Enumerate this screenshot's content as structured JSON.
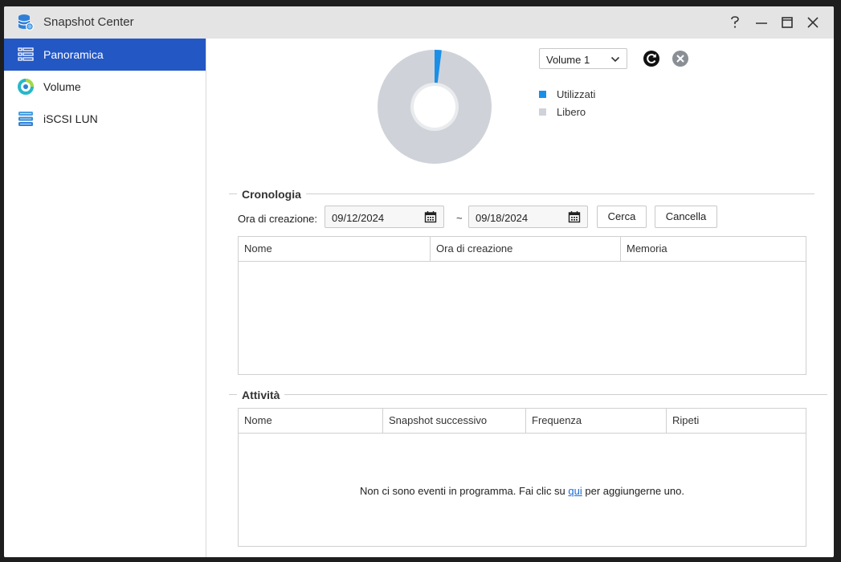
{
  "window": {
    "title": "Snapshot Center",
    "help_label": "?",
    "app_icon": "database-camera-icon"
  },
  "sidebar": {
    "items": [
      {
        "label": "Panoramica",
        "icon": "grid-list-icon",
        "active": true
      },
      {
        "label": "Volume",
        "icon": "volume-ring-icon",
        "active": false
      },
      {
        "label": "iSCSI LUN",
        "icon": "storage-stack-icon",
        "active": false
      }
    ]
  },
  "overview": {
    "volume_select": "Volume 1",
    "usage": {
      "used_fraction": 0.02
    },
    "legend": [
      {
        "label": "Utilizzati",
        "color": "#1a8fe8"
      },
      {
        "label": "Libero",
        "color": "#cfd3d9"
      }
    ]
  },
  "history": {
    "title": "Cronologia",
    "filter_label": "Ora di creazione:",
    "date_from": "09/12/2024",
    "date_to": "09/18/2024",
    "separator": "~",
    "search_button": "Cerca",
    "clear_button": "Cancella",
    "columns": [
      "Nome",
      "Ora di creazione",
      "Memoria"
    ]
  },
  "activities": {
    "title": "Attività",
    "columns": [
      "Nome",
      "Snapshot successivo",
      "Frequenza",
      "Ripeti"
    ],
    "empty_before": "Non ci sono eventi in programma. Fai clic su ",
    "empty_link": "qui",
    "empty_after": " per aggiungerne uno."
  }
}
